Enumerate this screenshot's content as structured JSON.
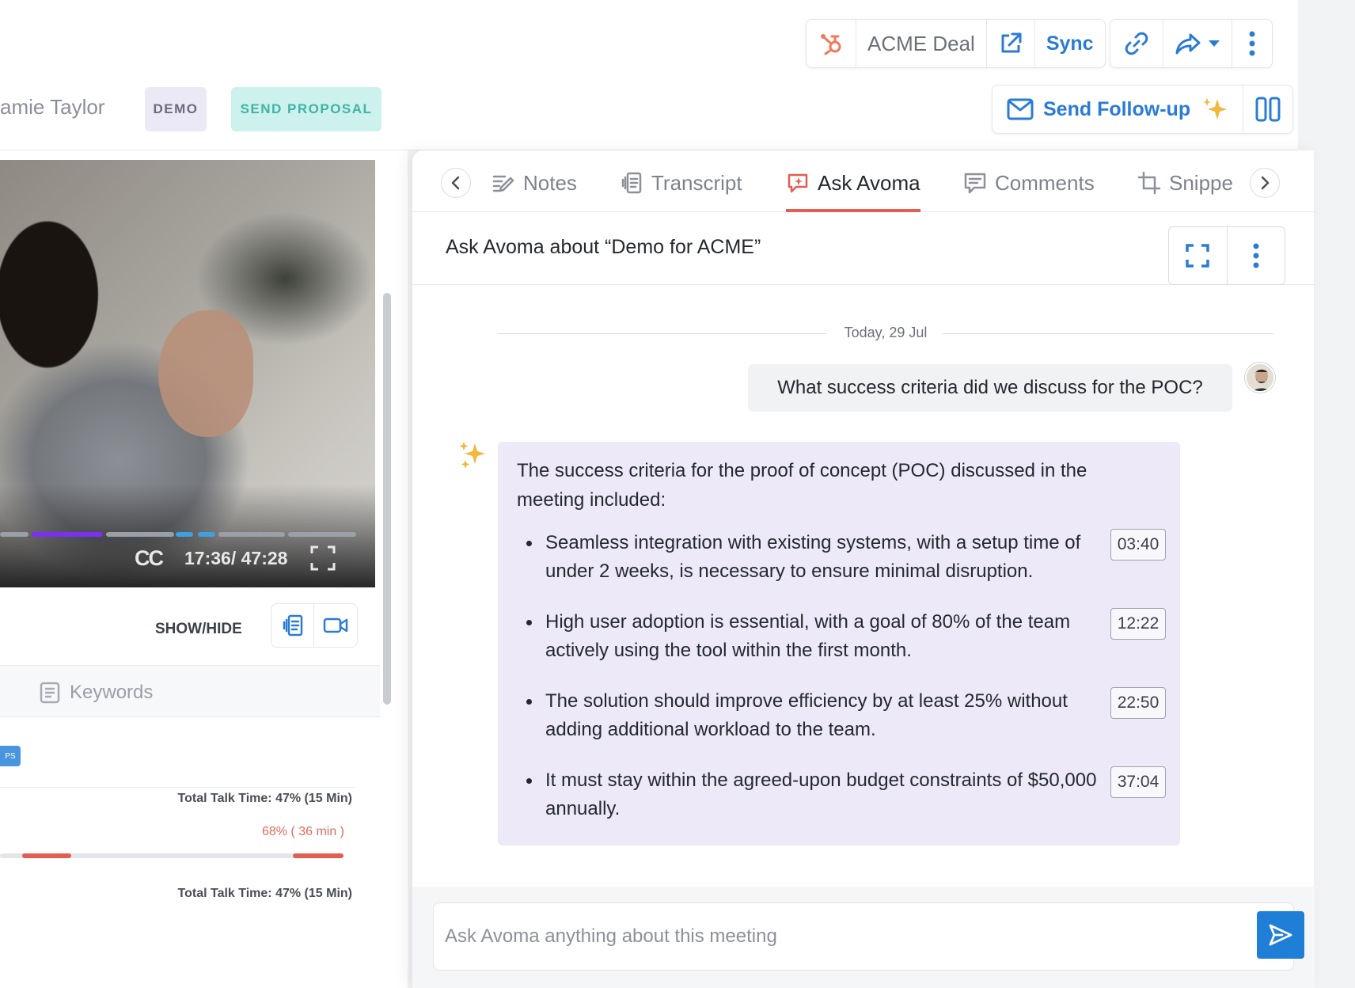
{
  "header": {
    "meeting_owner": "amie Taylor",
    "tags": {
      "demo": "DEMO",
      "stage": "SEND PROPOSAL"
    },
    "deal_label": "ACME Deal",
    "sync_label": "Sync",
    "follow_up_label": "Send Follow-up",
    "icons": [
      "hubspot-icon",
      "external-link-icon",
      "link-icon",
      "share-icon",
      "chevron-down-icon",
      "more-vertical-icon",
      "mail-icon",
      "sparkle-icon",
      "split-view-icon"
    ]
  },
  "player": {
    "cc_label": "CC",
    "time": "17:36/ 47:28",
    "progress": 0.37
  },
  "left_panel": {
    "show_hide_label": "SHOW/HIDE",
    "keywords_label": "Keywords",
    "talk_time_1": "Total Talk Time: 47% (15 Min)",
    "talk_pct": "68%  ( 36 min )",
    "talk_time_2": "Total Talk Time: 47% (15 Min)"
  },
  "tabs": [
    {
      "label": "Notes",
      "icon": "notes-icon"
    },
    {
      "label": "Transcript",
      "icon": "transcript-icon"
    },
    {
      "label": "Ask Avoma",
      "icon": "ask-avoma-icon",
      "active": true
    },
    {
      "label": "Comments",
      "icon": "comment-icon"
    },
    {
      "label": "Snippe",
      "icon": "crop-icon"
    }
  ],
  "ask": {
    "title": "Ask Avoma about “Demo for ACME”",
    "date_label": "Today, 29 Jul",
    "question": "What success criteria did we discuss for the POC?",
    "answer_intro": "The success criteria for the proof of concept (POC) discussed in the meeting included:",
    "answer_items": [
      {
        "text": "Seamless integration with existing systems, with a setup time of under 2 weeks, is necessary to ensure minimal disruption.",
        "timestamp": "03:40"
      },
      {
        "text": "High user adoption is essential, with a goal of 80% of the team actively using the tool within the first month.",
        "timestamp": "12:22"
      },
      {
        "text": "The solution should improve efficiency by at least 25% without adding additional workload to the team.",
        "timestamp": "22:50"
      },
      {
        "text": "It must stay within the agreed-upon budget constraints of $50,000 annually.",
        "timestamp": "37:04"
      }
    ],
    "input_placeholder": "Ask Avoma anything about this meeting"
  },
  "colors": {
    "accent_blue": "#2a7bd6",
    "active_tab_underline": "#e35d52",
    "ai_bubble_bg": "#ede9f8",
    "send_button": "#1f7fd6"
  }
}
